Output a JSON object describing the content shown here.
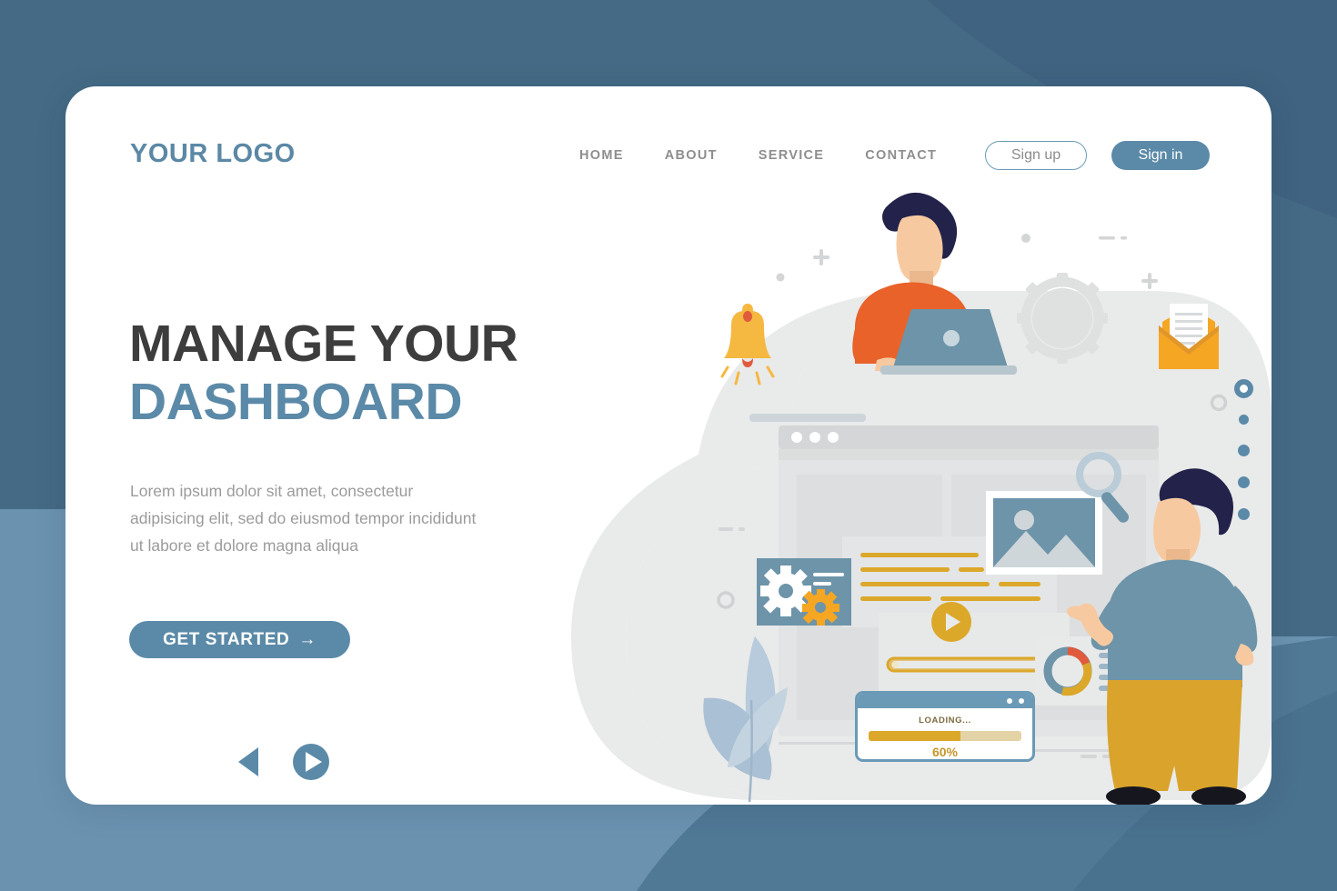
{
  "page": {
    "bg_color": "#446a85",
    "bg_color_light": "#6b93b0",
    "card_color": "#ffffff",
    "accent_blue": "#5b8aa8",
    "accent_gold": "#dca82a",
    "accent_orange": "#e8622a"
  },
  "header": {
    "logo": "YOUR LOGO",
    "nav": [
      {
        "label": "HOME"
      },
      {
        "label": "ABOUT"
      },
      {
        "label": "SERVICE"
      },
      {
        "label": "CONTACT"
      }
    ],
    "sign_up": "Sign up",
    "sign_in": "Sign in"
  },
  "hero": {
    "title_line1": "MANAGE YOUR",
    "title_line2": "DASHBOARD",
    "paragraph": "Lorem ipsum dolor sit amet, consectetur adipisicing elit, sed do eiusmod tempor incididunt ut labore et dolore magna aliqua",
    "cta_label": "GET STARTED",
    "cta_arrow": "→"
  },
  "illustration": {
    "loading_widget": {
      "label": "LOADING...",
      "percent_label": "60%",
      "percent_value": 60
    },
    "icons": [
      {
        "name": "bell-icon"
      },
      {
        "name": "envelope-icon"
      },
      {
        "name": "gear-icon"
      },
      {
        "name": "magnifier-icon"
      },
      {
        "name": "play-icon"
      },
      {
        "name": "image-placeholder-icon"
      },
      {
        "name": "donut-chart-icon"
      },
      {
        "name": "plant-icon"
      }
    ],
    "donut_chart": {
      "type": "pie",
      "title": "",
      "categories": [
        "Blue",
        "Gold",
        "Red"
      ],
      "values": [
        50,
        38,
        12
      ],
      "colors": [
        "#6a9ab6",
        "#dca82a",
        "#e05a3c"
      ]
    }
  },
  "carousel": {
    "prev_label": "previous",
    "next_label": "next",
    "dots": [
      {
        "active": true
      },
      {
        "active": false
      },
      {
        "active": false
      },
      {
        "active": false
      },
      {
        "active": false
      }
    ]
  }
}
